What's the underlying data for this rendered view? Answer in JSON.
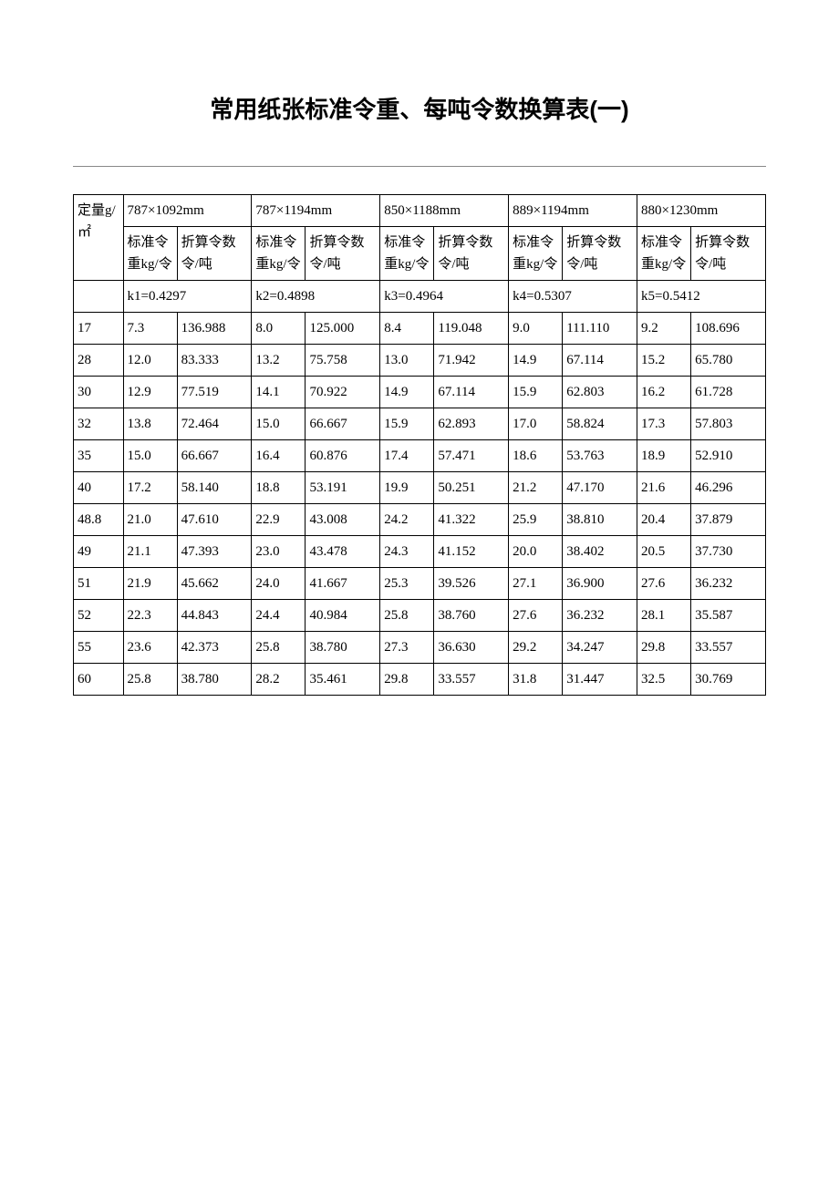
{
  "title": "常用纸张标准令重、每吨令数换算表(一)",
  "header": {
    "col0": "定量g/㎡",
    "sizes": [
      "787×1092mm",
      "787×1194mm",
      "850×1188mm",
      "889×1194mm",
      "880×1230mm"
    ],
    "sub_kg": "标准令重kg/令",
    "sub_ling": "折算令数令/吨",
    "k_labels": [
      "k1=0.4297",
      "k2=0.4898",
      "k3=0.4964",
      "k4=0.5307",
      "k5=0.5412"
    ]
  },
  "rows": [
    {
      "g": "17",
      "v": [
        "7.3",
        "136.988",
        "8.0",
        "125.000",
        "8.4",
        "119.048",
        "9.0",
        "111.110",
        "9.2",
        "108.696"
      ]
    },
    {
      "g": "28",
      "v": [
        "12.0",
        "83.333",
        "13.2",
        "75.758",
        "13.0",
        "71.942",
        "14.9",
        "67.114",
        "15.2",
        "65.780"
      ]
    },
    {
      "g": "30",
      "v": [
        "12.9",
        "77.519",
        "14.1",
        "70.922",
        "14.9",
        "67.114",
        "15.9",
        "62.803",
        "16.2",
        "61.728"
      ]
    },
    {
      "g": "32",
      "v": [
        "13.8",
        "72.464",
        "15.0",
        "66.667",
        "15.9",
        "62.893",
        "17.0",
        "58.824",
        "17.3",
        "57.803"
      ]
    },
    {
      "g": "35",
      "v": [
        "15.0",
        "66.667",
        "16.4",
        "60.876",
        "17.4",
        "57.471",
        "18.6",
        "53.763",
        "18.9",
        "52.910"
      ]
    },
    {
      "g": "40",
      "v": [
        "17.2",
        "58.140",
        "18.8",
        "53.191",
        "19.9",
        "50.251",
        "21.2",
        "47.170",
        "21.6",
        "46.296"
      ]
    },
    {
      "g": "48.8",
      "v": [
        "21.0",
        "47.610",
        "22.9",
        "43.008",
        "24.2",
        "41.322",
        "25.9",
        "38.810",
        "20.4",
        "37.879"
      ]
    },
    {
      "g": "49",
      "v": [
        "21.1",
        "47.393",
        "23.0",
        "43.478",
        "24.3",
        "41.152",
        "20.0",
        "38.402",
        "20.5",
        "37.730"
      ]
    },
    {
      "g": "51",
      "v": [
        "21.9",
        "45.662",
        "24.0",
        "41.667",
        "25.3",
        "39.526",
        "27.1",
        "36.900",
        "27.6",
        "36.232"
      ]
    },
    {
      "g": "52",
      "v": [
        "22.3",
        "44.843",
        "24.4",
        "40.984",
        "25.8",
        "38.760",
        "27.6",
        "36.232",
        "28.1",
        "35.587"
      ]
    },
    {
      "g": "55",
      "v": [
        "23.6",
        "42.373",
        "25.8",
        "38.780",
        "27.3",
        "36.630",
        "29.2",
        "34.247",
        "29.8",
        "33.557"
      ]
    },
    {
      "g": "60",
      "v": [
        "25.8",
        "38.780",
        "28.2",
        "35.461",
        "29.8",
        "33.557",
        "31.8",
        "31.447",
        "32.5",
        "30.769"
      ]
    }
  ]
}
